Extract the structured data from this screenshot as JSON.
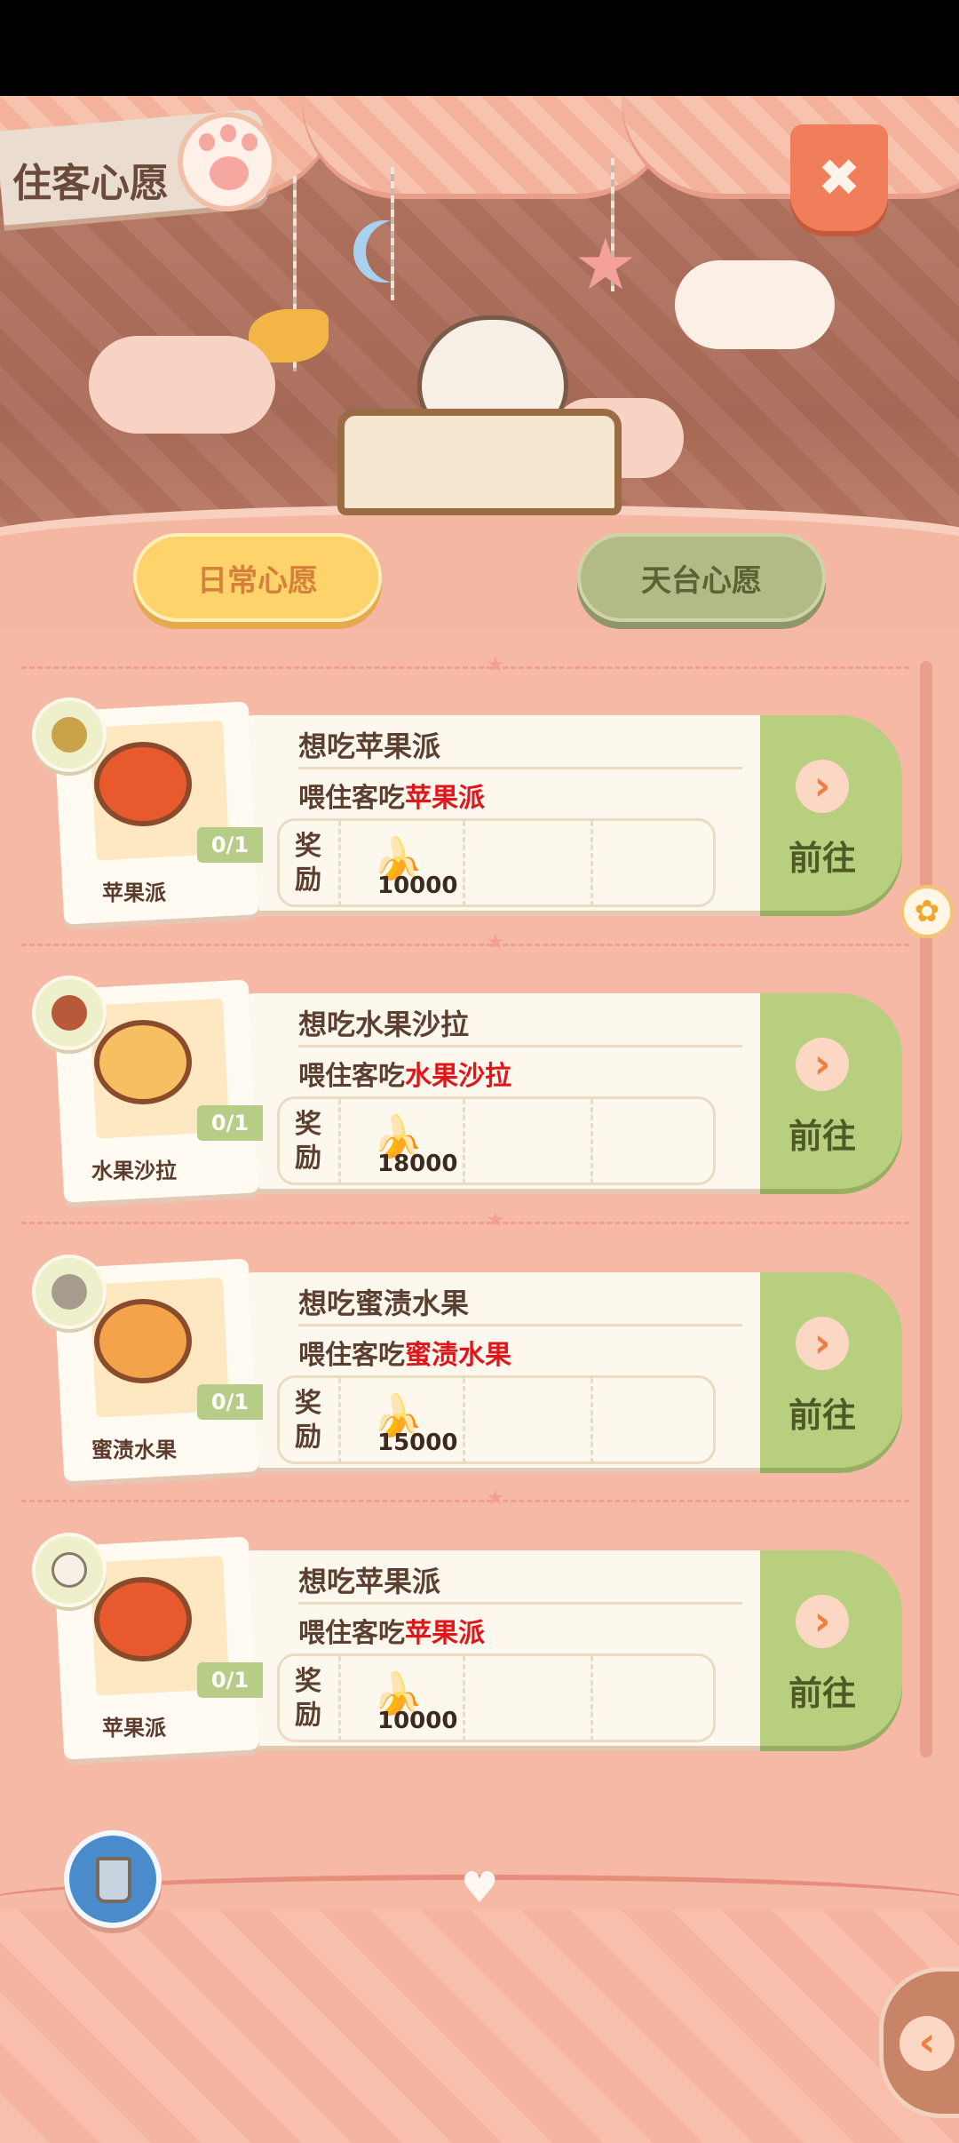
{
  "header": {
    "title": "住客心愿",
    "close_icon": "close-icon",
    "close_symbol": "✖"
  },
  "tabs": [
    {
      "label": "日常心愿",
      "active": true
    },
    {
      "label": "天台心愿",
      "active": false
    }
  ],
  "wishes": [
    {
      "title": "想吃苹果派",
      "desc_prefix": "喂住客吃",
      "desc_food": "苹果派",
      "food_name": "苹果派",
      "progress": "0/1",
      "reward_label": "奖励",
      "reward_amount": "10000",
      "goto_label": "前往",
      "avatar": "sunflower-guest",
      "food_icon": "apple-pie"
    },
    {
      "title": "想吃水果沙拉",
      "desc_prefix": "喂住客吃",
      "desc_food": "水果沙拉",
      "food_name": "水果沙拉",
      "progress": "0/1",
      "reward_label": "奖励",
      "reward_amount": "18000",
      "goto_label": "前往",
      "avatar": "burger-guest",
      "food_icon": "fruit-salad"
    },
    {
      "title": "想吃蜜渍水果",
      "desc_prefix": "喂住客吃",
      "desc_food": "蜜渍水果",
      "food_name": "蜜渍水果",
      "progress": "0/1",
      "reward_label": "奖励",
      "reward_amount": "15000",
      "goto_label": "前往",
      "avatar": "bunny-guest",
      "food_icon": "candied-fruit"
    },
    {
      "title": "想吃苹果派",
      "desc_prefix": "喂住客吃",
      "desc_food": "苹果派",
      "food_name": "苹果派",
      "progress": "0/1",
      "reward_label": "奖励",
      "reward_amount": "10000",
      "goto_label": "前往",
      "avatar": "dumpling-guest",
      "food_icon": "apple-pie"
    }
  ],
  "icons": {
    "banana": "banana-icon",
    "goto_arrow": "chevron-right-icon",
    "back_arrow": "chevron-left-icon",
    "trash": "trash-icon",
    "scroll_paw": "paw-icon"
  },
  "colors": {
    "highlight": "#e0161b",
    "goto_green": "#b9cf80",
    "tab_active": "#ffd36b",
    "tab_inactive": "#b3ba86"
  }
}
